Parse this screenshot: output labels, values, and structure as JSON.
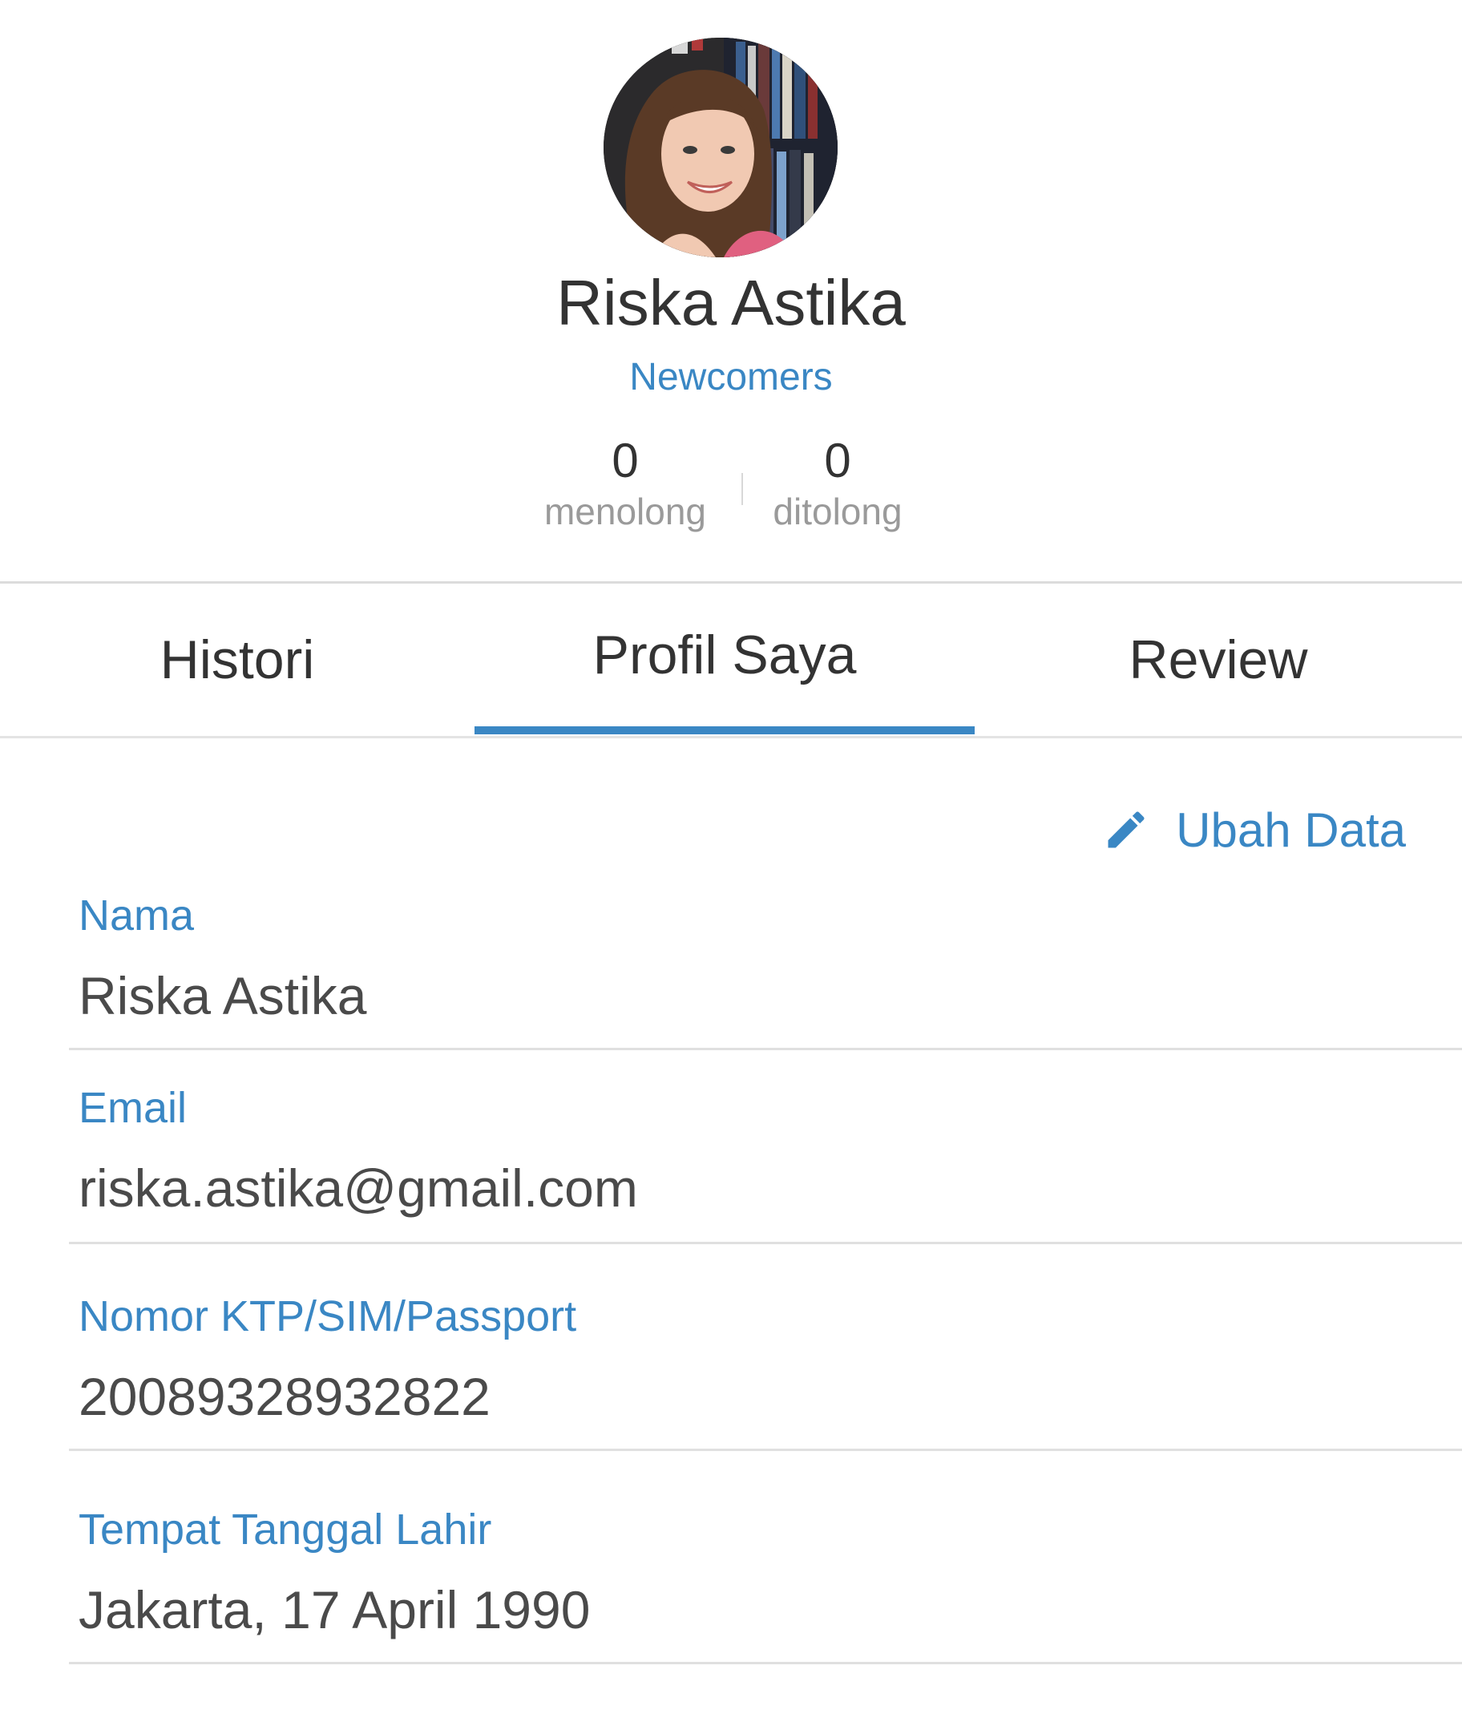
{
  "profile": {
    "name": "Riska Astika",
    "level": "Newcomers",
    "stats": [
      {
        "value": "0",
        "label": "menolong"
      },
      {
        "value": "0",
        "label": "ditolong"
      }
    ]
  },
  "tabs": [
    {
      "label": "Histori",
      "active": false
    },
    {
      "label": "Profil Saya",
      "active": true
    },
    {
      "label": "Review",
      "active": false
    }
  ],
  "edit": {
    "label": "Ubah Data",
    "icon": "pencil-icon"
  },
  "fields": [
    {
      "label": "Nama",
      "value": "Riska Astika"
    },
    {
      "label": "Email",
      "value": "riska.astika@gmail.com"
    },
    {
      "label": "Nomor KTP/SIM/Passport",
      "value": "20089328932822"
    },
    {
      "label": "Tempat Tanggal Lahir",
      "value": "Jakarta, 17 April 1990"
    }
  ],
  "colors": {
    "accent": "#3a87c4",
    "text": "#333333",
    "muted": "#9a9a9a",
    "divider": "#e0e0e0"
  }
}
